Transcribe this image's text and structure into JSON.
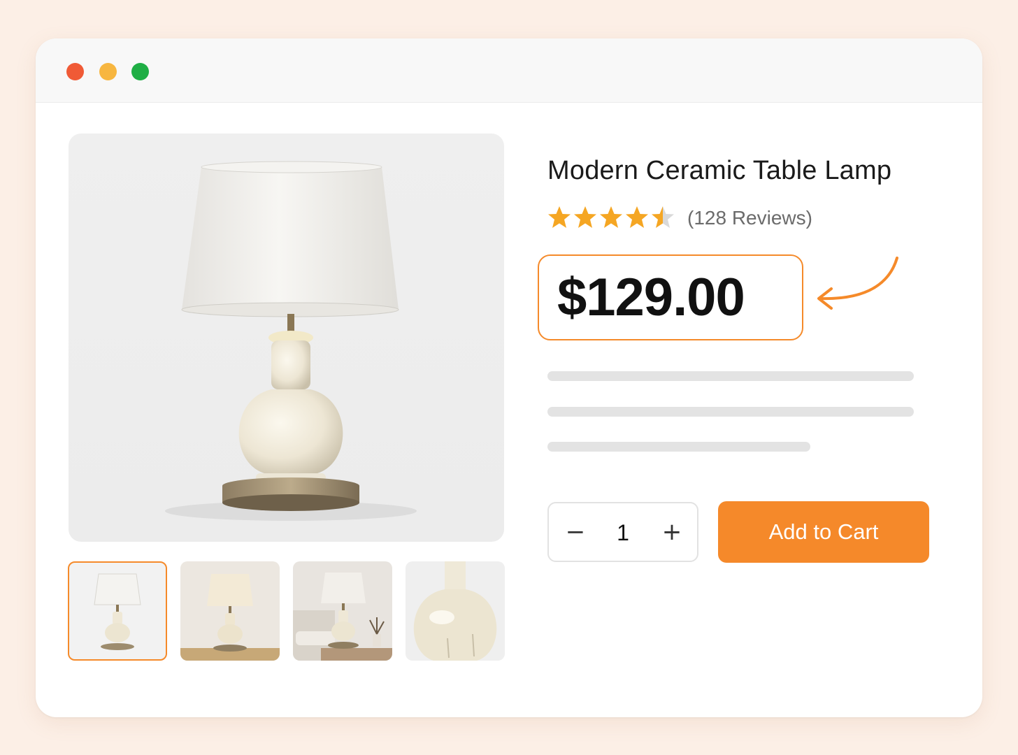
{
  "product": {
    "title": "Modern Ceramic Table Lamp",
    "rating": 4.5,
    "reviews_label": "(128 Reviews)",
    "price": "$129.00"
  },
  "gallery": {
    "main_image": "table-lamp-main-photo",
    "thumbnails": [
      "lamp-white-background",
      "lamp-lit-on-table",
      "lamp-bedroom-scene",
      "lamp-ceramic-base-closeup"
    ],
    "selected_index": 0
  },
  "quantity": {
    "value": "1",
    "decrement_icon": "minus-icon",
    "increment_icon": "plus-icon"
  },
  "cart": {
    "button_label": "Add to Cart"
  },
  "colors": {
    "accent": "#f58a2a",
    "star": "#f5a623",
    "background": "#fcefe6"
  }
}
